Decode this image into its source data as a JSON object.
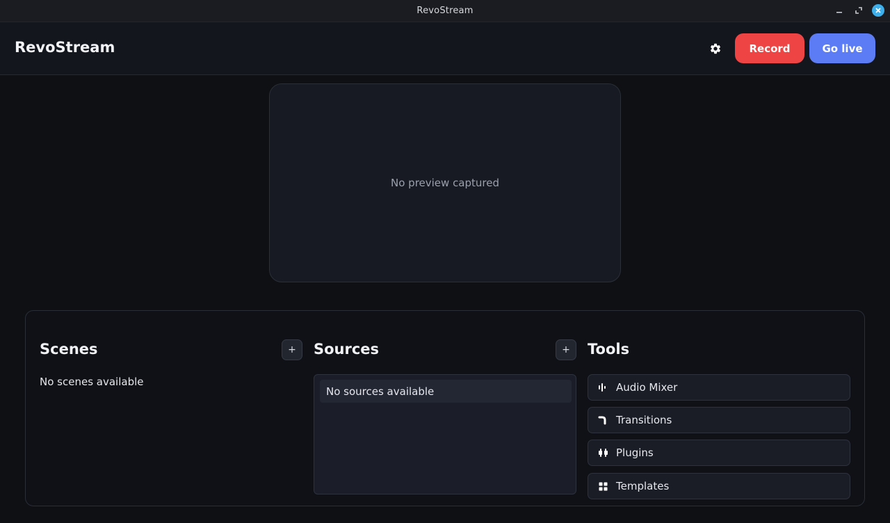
{
  "window": {
    "title": "RevoStream",
    "controls": [
      "minimize-icon",
      "restore-icon",
      "close-icon"
    ]
  },
  "header": {
    "app_name": "RevoStream",
    "settings_icon": "gear-icon",
    "record_label": "Record",
    "golive_label": "Go live"
  },
  "preview": {
    "empty_text": "No preview captured"
  },
  "scenes": {
    "title": "Scenes",
    "add_label": "+",
    "empty_text": "No scenes available"
  },
  "sources": {
    "title": "Sources",
    "add_label": "+",
    "empty_text": "No sources available"
  },
  "tools": {
    "title": "Tools",
    "items": [
      {
        "label": "Audio Mixer",
        "icon": "audio-mixer-icon"
      },
      {
        "label": "Transitions",
        "icon": "transitions-icon"
      },
      {
        "label": "Plugins",
        "icon": "plugins-icon"
      },
      {
        "label": "Templates",
        "icon": "templates-icon"
      }
    ]
  },
  "colors": {
    "record": "#ef4444",
    "golive": "#5b7cf5",
    "close_button": "#3daee9"
  }
}
